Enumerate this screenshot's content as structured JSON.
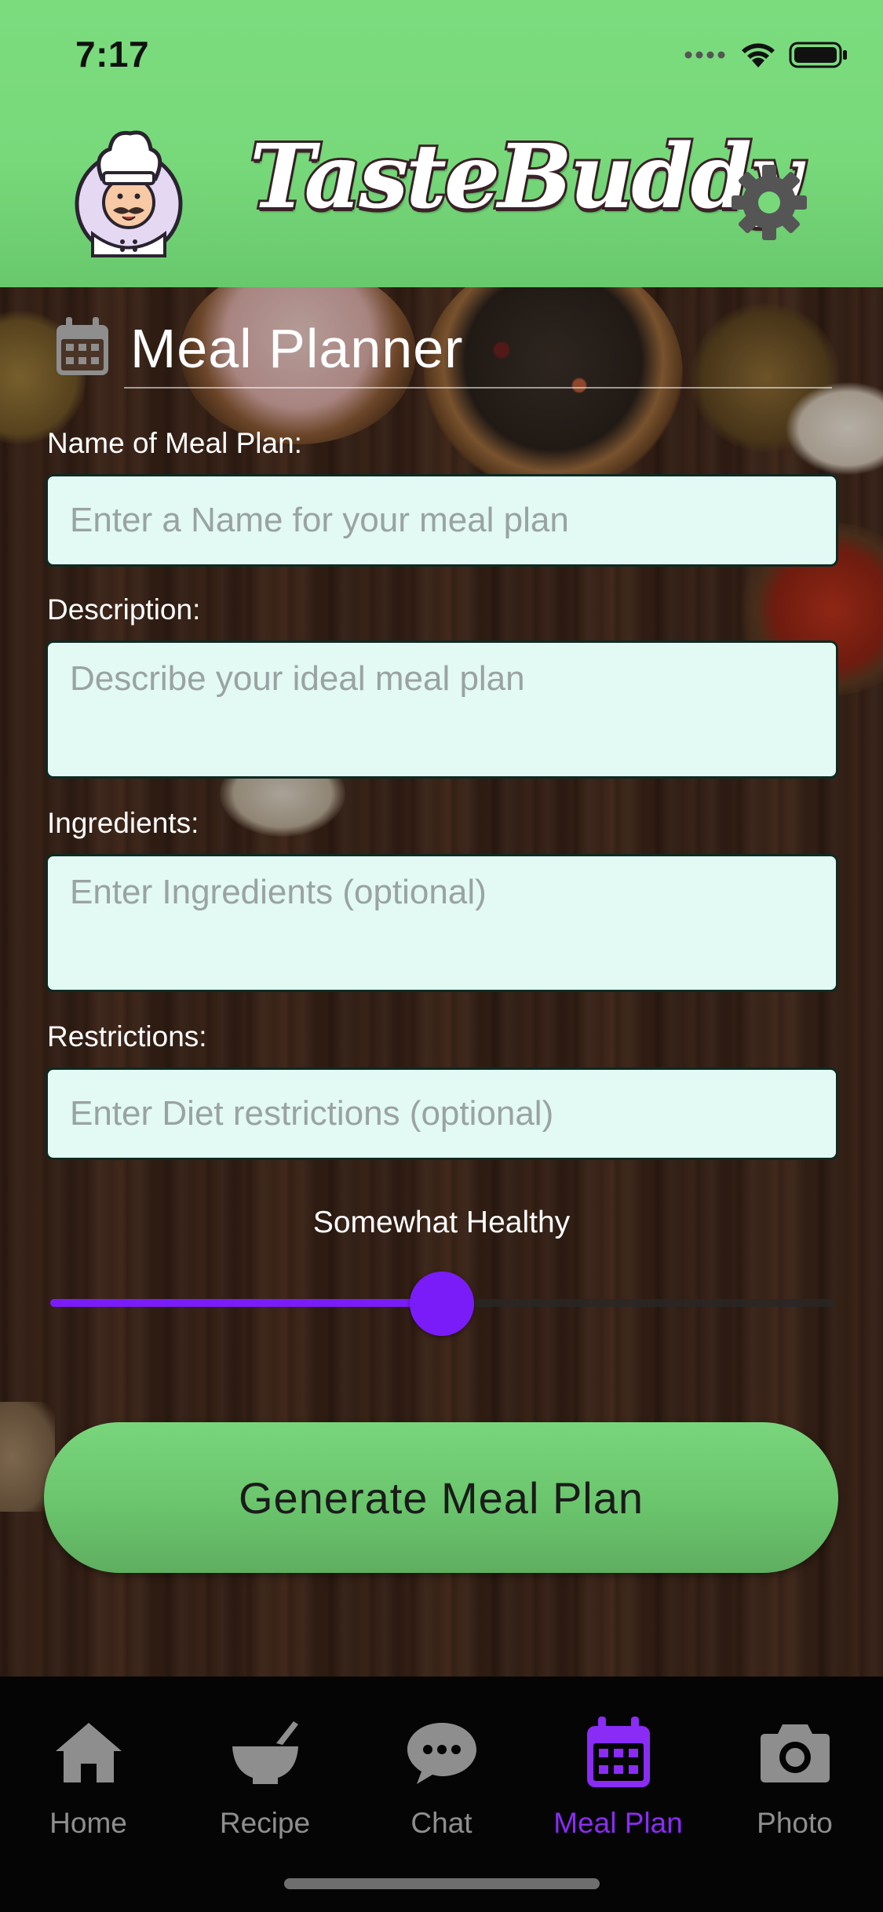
{
  "status_bar": {
    "time": "7:17"
  },
  "header": {
    "app_title": "TasteBuddy",
    "logo_icon": "chef-mascot",
    "settings_icon": "gear"
  },
  "planner": {
    "title": "Meal Planner",
    "title_icon": "calendar",
    "name_field": {
      "label": "Name of Meal Plan:",
      "value": "",
      "placeholder": "Enter a Name for your meal plan"
    },
    "description_field": {
      "label": "Description:",
      "value": "",
      "placeholder": "Describe your ideal meal plan"
    },
    "ingredients_field": {
      "label": "Ingredients:",
      "value": "",
      "placeholder": "Enter Ingredients (optional)"
    },
    "restrictions_field": {
      "label": "Restrictions:",
      "value": "",
      "placeholder": "Enter Diet restrictions (optional)"
    },
    "health_slider": {
      "label": "Somewhat Healthy",
      "value": 0.5
    },
    "generate_button": "Generate Meal Plan"
  },
  "tab_bar": {
    "tabs": [
      {
        "label": "Home",
        "icon": "home",
        "active": false
      },
      {
        "label": "Recipe",
        "icon": "mortar-pestle",
        "active": false
      },
      {
        "label": "Chat",
        "icon": "chat-bubble",
        "active": false
      },
      {
        "label": "Meal Plan",
        "icon": "calendar",
        "active": true
      },
      {
        "label": "Photo",
        "icon": "camera",
        "active": false
      }
    ]
  },
  "colors": {
    "header_green": "#78d97b",
    "accent_purple": "#7a1cf8",
    "active_tab": "#8a2cf5",
    "inactive_tab": "#8e8e8e",
    "field_bg": "#e2f9f4",
    "button_green": "#6ac56c"
  }
}
